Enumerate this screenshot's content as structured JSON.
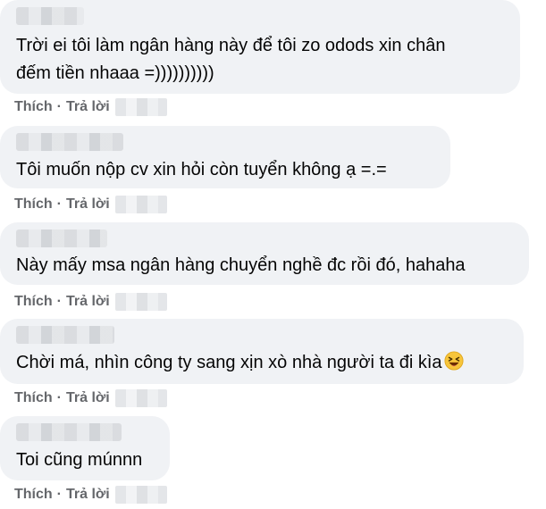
{
  "comments": [
    {
      "text": "Trời ei tôi làm ngân hàng này để tôi zo odods xin chân\nđếm tiền nhaaa =))))))))))",
      "like_label": "Thích",
      "reply_label": "Trả lời",
      "has_emoji": false
    },
    {
      "text": "Tôi muốn nộp cv xin hỏi còn tuyển không ạ =.=",
      "like_label": "Thích",
      "reply_label": "Trả lời",
      "has_emoji": false
    },
    {
      "text": "Này mấy msa ngân hàng chuyển nghề đc rồi đó, hahaha",
      "like_label": "Thích",
      "reply_label": "Trả lời",
      "has_emoji": false
    },
    {
      "text": "Chời má, nhìn công ty sang xịn xò nhà người ta đi kìa",
      "like_label": "Thích",
      "reply_label": "Trả lời",
      "has_emoji": true,
      "emoji_icon": "laughing-face-icon"
    },
    {
      "text": "Toi cũng múnnn",
      "like_label": "Thích",
      "reply_label": "Trả lời",
      "has_emoji": false
    }
  ],
  "separator": "·",
  "colors": {
    "bubble": "#f0f2f5",
    "text": "#050505",
    "meta": "#65676b"
  }
}
